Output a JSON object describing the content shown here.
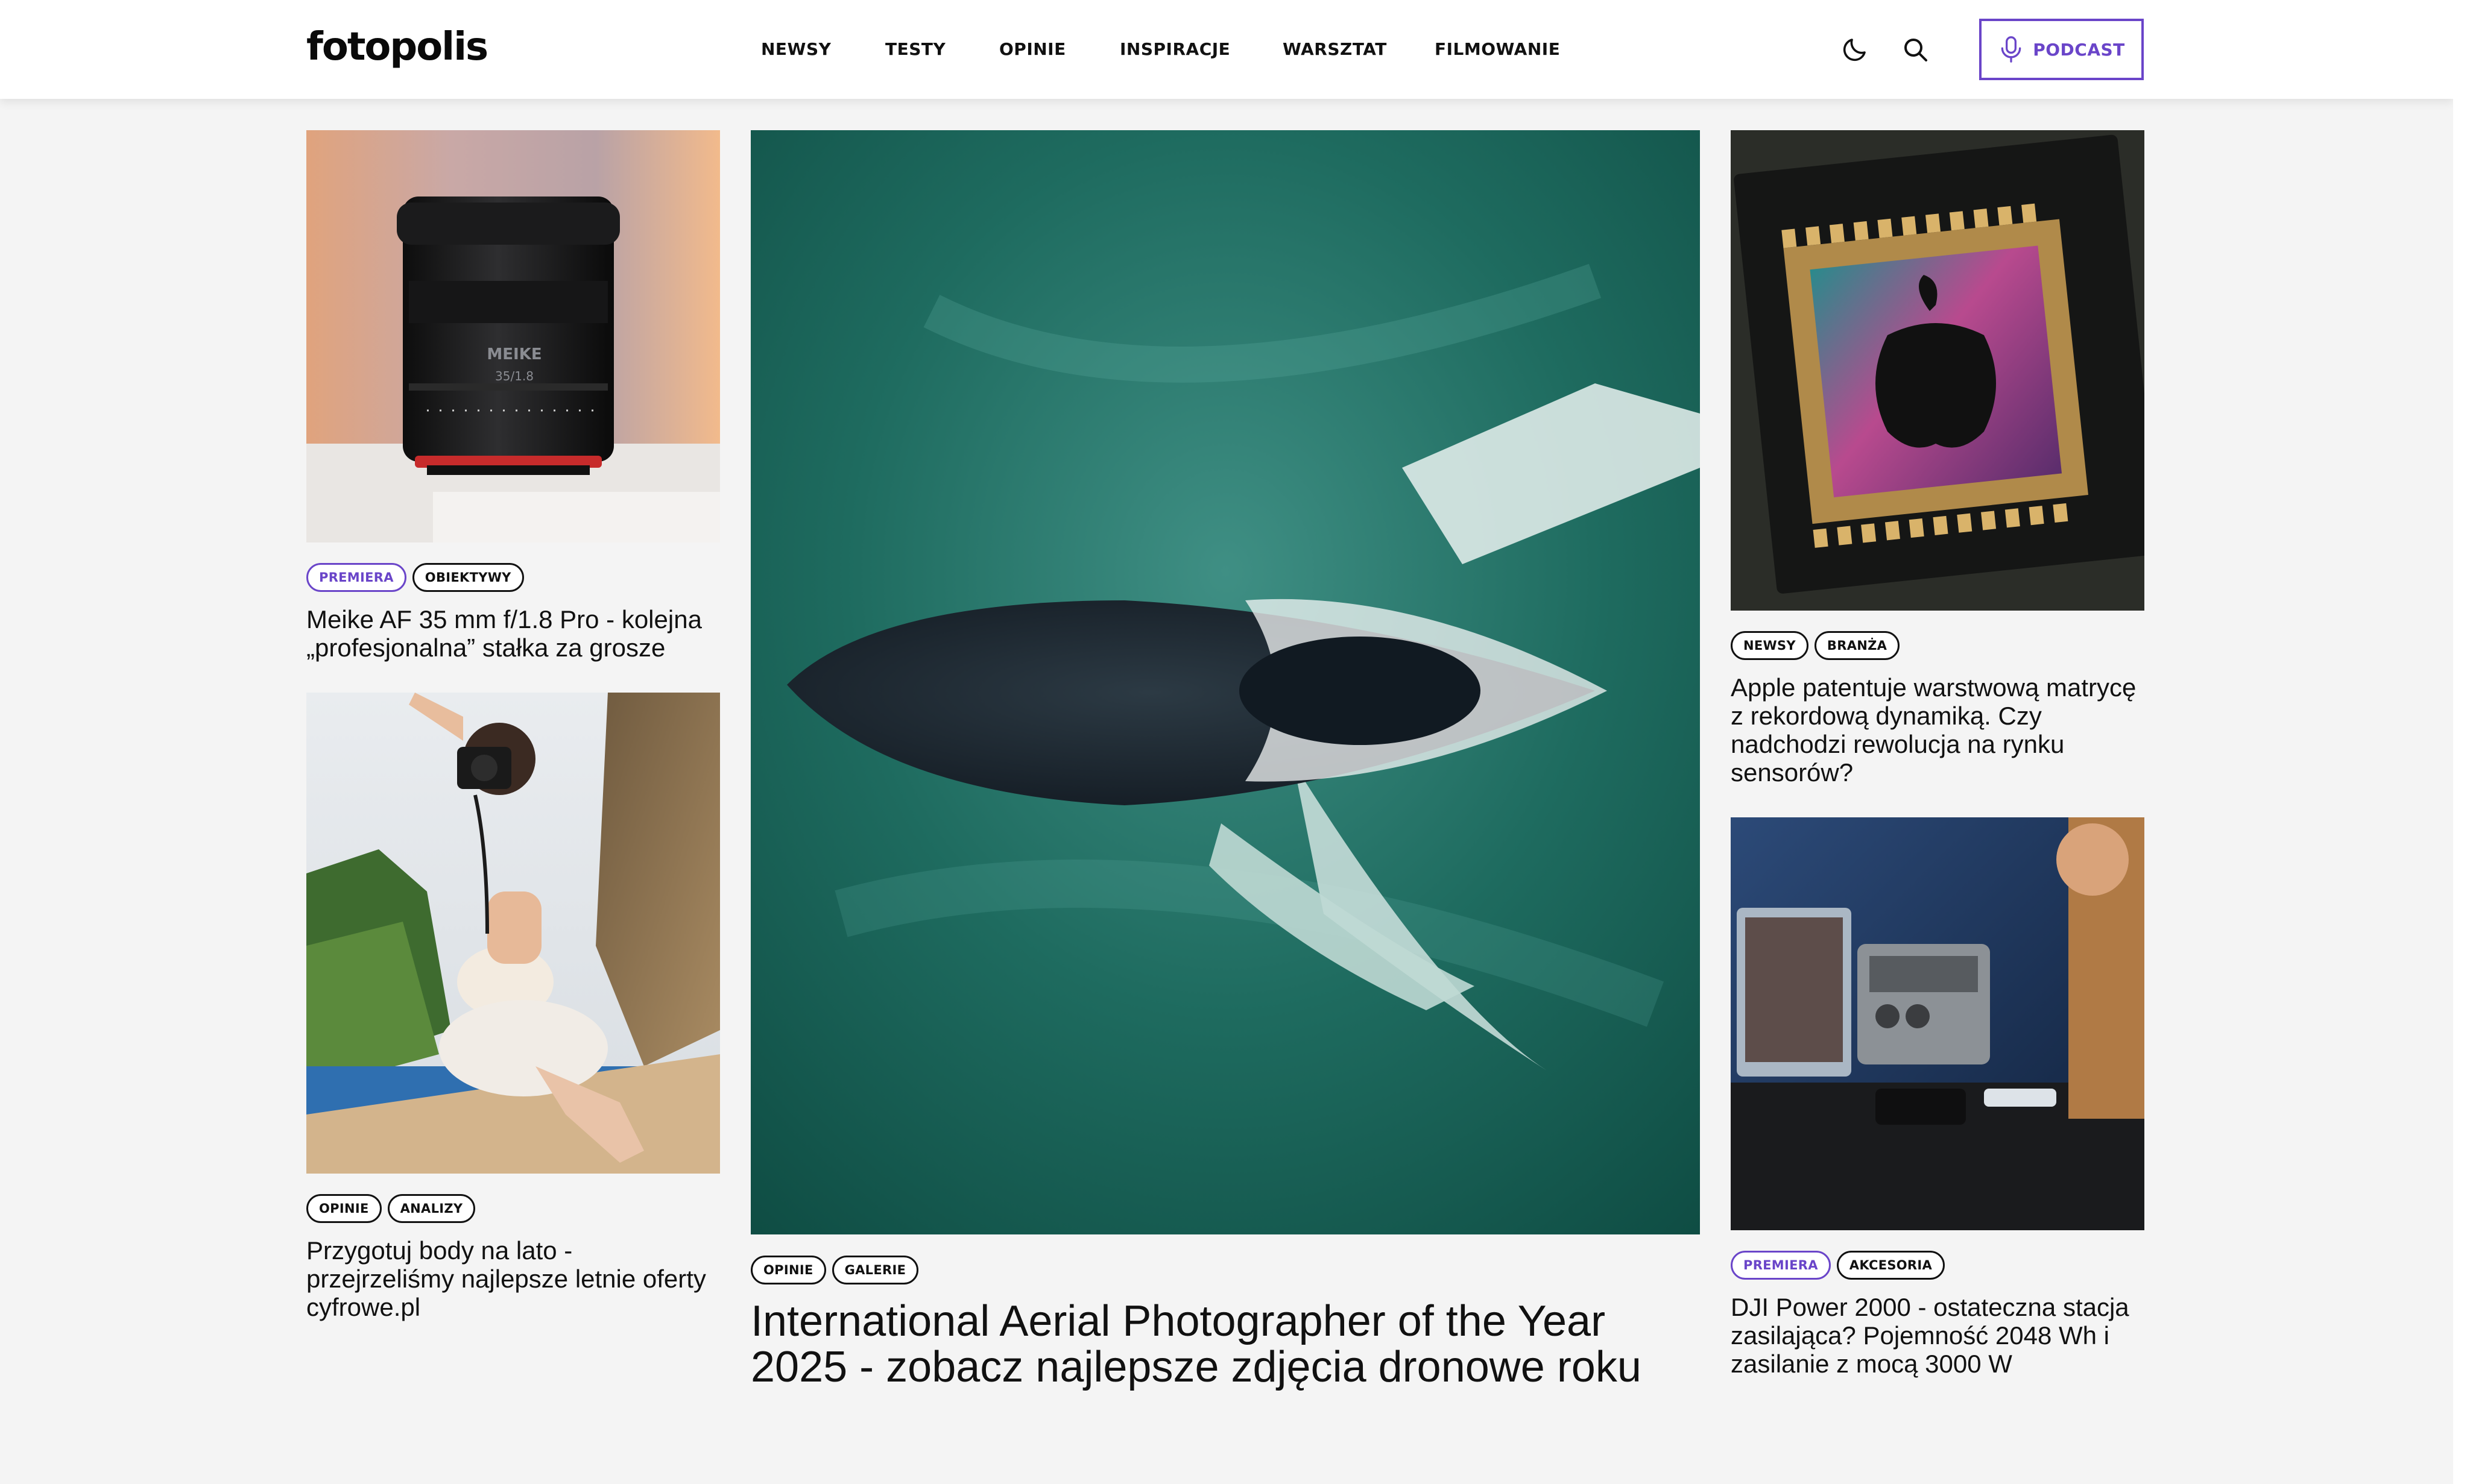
{
  "brand": {
    "logo_text": "fotopolis",
    "accent_color": "#6a45c9"
  },
  "nav": {
    "items": [
      "NEWSY",
      "TESTY",
      "OPINIE",
      "INSPIRACJE",
      "WARSZTAT",
      "FILMOWANIE"
    ],
    "icons": [
      "moon-icon",
      "search-icon"
    ],
    "podcast_label": "PODCAST",
    "podcast_icon": "microphone-icon"
  },
  "articles": {
    "left_top": {
      "tags": [
        "PREMIERA",
        "OBIEKTYWY"
      ],
      "title": "Meike AF 35 mm f/1.8 Pro - kolejna „profesjonalna” stałka za grosze",
      "lens_markings": [
        "MEIKE",
        "35/1.8"
      ]
    },
    "left_bottom": {
      "tags": [
        "OPINIE",
        "ANALIZY"
      ],
      "title": "Przygotuj body na lato - przejrzeliśmy najlepsze letnie oferty cyfrowe.pl"
    },
    "featured": {
      "tags": [
        "OPINIE",
        "GALERIE"
      ],
      "title": "International Aerial Photographer of the Year 2025 - zobacz najlepsze zdjęcia dronowe roku"
    },
    "right_top": {
      "tags": [
        "NEWSY",
        "BRANŻA"
      ],
      "title": "Apple patentuje warstwową matrycę z rekordową dynamiką. Czy nadchodzi rewolucja na rynku sensorów?"
    },
    "right_bottom": {
      "tags": [
        "PREMIERA",
        "AKCESORIA"
      ],
      "title": "DJI Power 2000 - ostateczna stacja zasilająca? Pojemność 2048 Wh i zasilanie z mocą 3000 W"
    }
  }
}
